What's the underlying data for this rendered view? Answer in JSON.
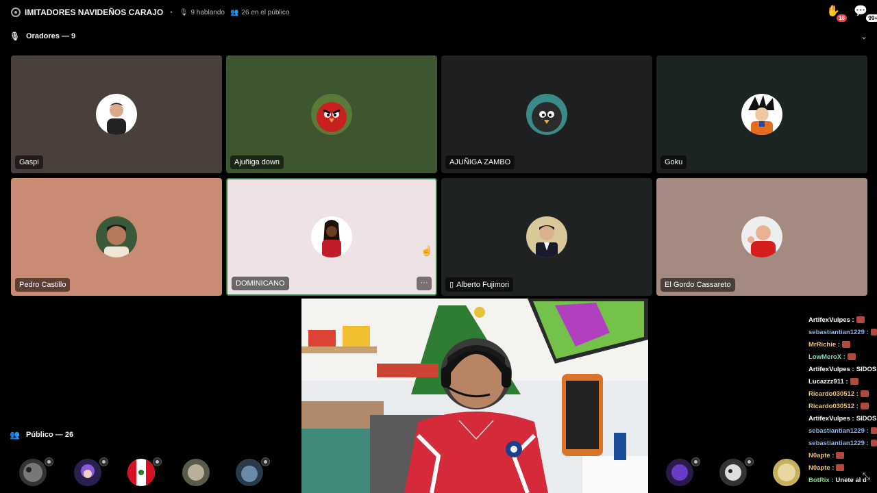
{
  "topbar": {
    "title": "IMITADORES NAVIDEÑOS CARAJO",
    "speaking": "9 hablando",
    "audience": "26 en el público",
    "hand_badge": "16",
    "chat_badge": "99+"
  },
  "speakers_header": "Oradores — 9",
  "audience_header": "Público — 26",
  "speakers": [
    {
      "name": "Gaspi",
      "bg": "#4a3f3a"
    },
    {
      "name": "Ajuñiga down",
      "bg": "#3e5630"
    },
    {
      "name": "AJUÑIGA ZAMBO",
      "bg": "#1d1f21"
    },
    {
      "name": "Goku",
      "bg": "#1c2421"
    },
    {
      "name": "Pedro Castillo",
      "bg": "#c98b74"
    },
    {
      "name": "DOMINICANO",
      "bg": "#eee2e4",
      "more": "···"
    },
    {
      "name": "Alberto Fujimori",
      "bg": "#1e2321"
    },
    {
      "name": "El Gordo Cassareto",
      "bg": "#a58a82"
    }
  ],
  "chat": [
    {
      "user": "ArtifexVulpes :",
      "color": "#ffffff",
      "msg": ""
    },
    {
      "user": "sebastiantian1229 :",
      "color": "#8ab4f8",
      "msg": ""
    },
    {
      "user": "MrRichie :",
      "color": "#f5c16c",
      "msg": ""
    },
    {
      "user": "LowMeroX :",
      "color": "#7ee0c3",
      "msg": ""
    },
    {
      "user": "ArtifexVulpes :",
      "color": "#ffffff",
      "msg": "SIDOS"
    },
    {
      "user": "Lucazzz911 :",
      "color": "#ffffff",
      "msg": ""
    },
    {
      "user": "Ricardo030512 :",
      "color": "#f5c16c",
      "msg": ""
    },
    {
      "user": "Ricardo030512 :",
      "color": "#f5c16c",
      "msg": ""
    },
    {
      "user": "ArtifexVulpes :",
      "color": "#ffffff",
      "msg": "SIDOS"
    },
    {
      "user": "sebastiantian1229 :",
      "color": "#8ab4f8",
      "msg": ""
    },
    {
      "user": "sebastiantian1229 :",
      "color": "#8ab4f8",
      "msg": ""
    },
    {
      "user": "N0apte :",
      "color": "#f5c16c",
      "msg": ""
    },
    {
      "user": "N0apte :",
      "color": "#f5c16c",
      "msg": ""
    },
    {
      "user": "BotRix :",
      "color": "#7ee07e",
      "msg": "Unete al d"
    }
  ],
  "colors": {
    "accent_green": "#2d7d46",
    "badge_red": "#f23f43"
  }
}
